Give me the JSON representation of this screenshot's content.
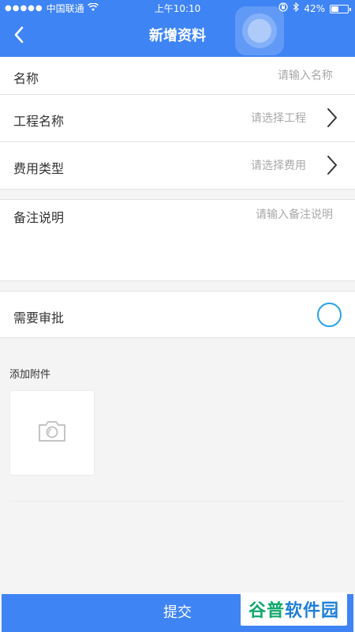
{
  "status_bar": {
    "carrier": "中国联通",
    "time": "上午10:10",
    "battery": "42%"
  },
  "nav": {
    "title": "新增资料",
    "back_icon": "chevron-left-icon"
  },
  "form": {
    "name": {
      "label": "名称",
      "placeholder": "请输入名称"
    },
    "project": {
      "label": "工程名称",
      "placeholder": "请选择工程"
    },
    "expense_type": {
      "label": "费用类型",
      "placeholder": "请选择费用"
    },
    "remark": {
      "label": "备注说明",
      "placeholder": "请输入备注说明"
    },
    "approval": {
      "label": "需要审批",
      "checked": false
    }
  },
  "attachments": {
    "label": "添加附件",
    "add_icon": "camera-icon"
  },
  "submit": {
    "label": "提交"
  },
  "watermark": {
    "text_a": "谷普",
    "text_b": "软件园"
  },
  "colors": {
    "primary": "#3f84f5",
    "toggle_ring": "#29a3e6",
    "placeholder": "#a8a8a8"
  }
}
